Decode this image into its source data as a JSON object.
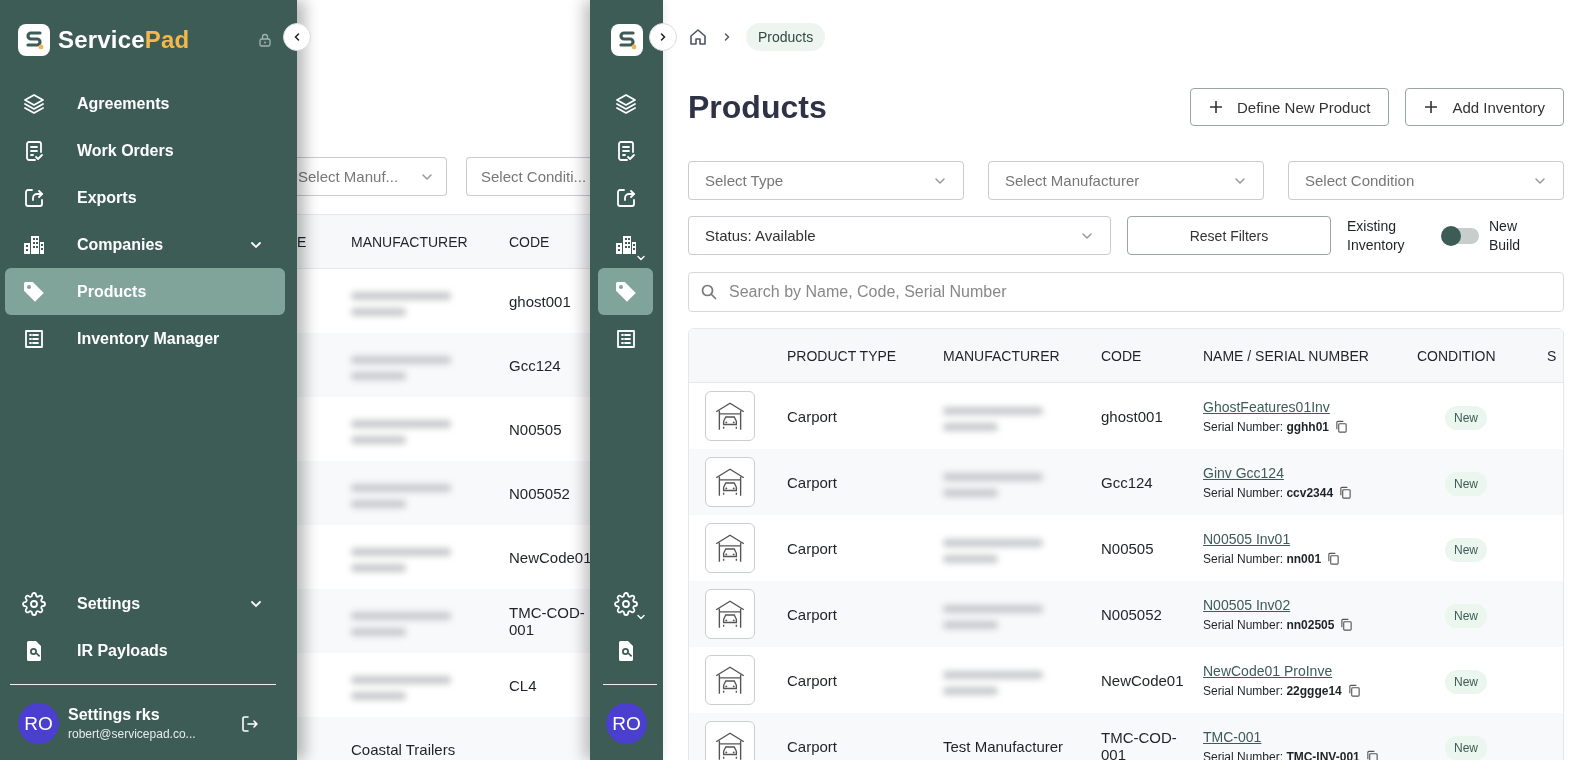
{
  "expanded_view": {
    "sidebar": {
      "brand": {
        "name": "Service",
        "accent": "Pad"
      },
      "items": [
        {
          "label": "Agreements",
          "kind": "layers",
          "selected": false,
          "expandable": false
        },
        {
          "label": "Work Orders",
          "kind": "checklist",
          "selected": false,
          "expandable": false
        },
        {
          "label": "Exports",
          "kind": "export",
          "selected": false,
          "expandable": false
        },
        {
          "label": "Companies",
          "kind": "buildings",
          "selected": false,
          "expandable": true
        },
        {
          "label": "Products",
          "kind": "tag",
          "selected": true,
          "expandable": false
        },
        {
          "label": "Inventory Manager",
          "kind": "list",
          "selected": false,
          "expandable": false
        }
      ],
      "bottom_items": [
        {
          "label": "Settings",
          "kind": "gear",
          "selected": false,
          "expandable": true
        },
        {
          "label": "IR Payloads",
          "kind": "search-doc",
          "selected": false,
          "expandable": false
        }
      ],
      "user": {
        "initials": "RO",
        "name": "Settings rks",
        "email": "robert@servicepad.co..."
      }
    },
    "background_page": {
      "filters": [
        "Select Manuf...",
        "Select Conditi..."
      ],
      "columns": [
        "E",
        "MANUFACTURER",
        "CODE"
      ],
      "rows": [
        {
          "manufacturer_blurred": true,
          "code": "ghost001"
        },
        {
          "manufacturer_blurred": true,
          "code": "Gcc124"
        },
        {
          "manufacturer_blurred": true,
          "code": "N00505"
        },
        {
          "manufacturer_blurred": true,
          "code": "N005052"
        },
        {
          "manufacturer_blurred": true,
          "code": "NewCode01"
        },
        {
          "manufacturer_blurred": true,
          "code": "TMC-COD-001"
        },
        {
          "manufacturer_blurred": true,
          "code": "CL4"
        },
        {
          "manufacturer_blurred": false,
          "manufacturer": "Coastal Trailers"
        }
      ]
    }
  },
  "collapsed_view": {
    "sidebar": {
      "items": [
        {
          "kind": "layers",
          "selected": false,
          "expandable": false
        },
        {
          "kind": "checklist",
          "selected": false,
          "expandable": false
        },
        {
          "kind": "export",
          "selected": false,
          "expandable": false
        },
        {
          "kind": "buildings",
          "selected": false,
          "expandable": true
        },
        {
          "kind": "tag",
          "selected": true,
          "expandable": false
        },
        {
          "kind": "list",
          "selected": false,
          "expandable": false
        }
      ],
      "bottom_items": [
        {
          "kind": "gear",
          "selected": false,
          "expandable": true
        },
        {
          "kind": "search-doc",
          "selected": false,
          "expandable": false
        }
      ],
      "user": {
        "initials": "RO"
      }
    },
    "breadcrumb": {
      "current": "Products"
    },
    "title": "Products",
    "actions": [
      "Define New Product",
      "Add Inventory"
    ],
    "filters": [
      {
        "placeholder": "Select Type"
      },
      {
        "placeholder": "Select Manufacturer"
      },
      {
        "placeholder": "Select Condition"
      }
    ],
    "status_filter": {
      "value": "Status: Available"
    },
    "reset_button": "Reset Filters",
    "inventory_toggle": {
      "left_label": "Existing Inventory",
      "right_label": "New Build",
      "on": false
    },
    "search": {
      "placeholder": "Search by Name, Code, Serial Number"
    },
    "table": {
      "columns": [
        "PRODUCT TYPE",
        "MANUFACTURER",
        "CODE",
        "NAME / SERIAL NUMBER",
        "CONDITION",
        "S"
      ],
      "rows": [
        {
          "product_type": "Carport",
          "manufacturer_blurred": true,
          "code": "ghost001",
          "name": "GhostFeatures01Inv",
          "serial_label": "Serial Number:",
          "serial": "gghh01",
          "condition": "New"
        },
        {
          "product_type": "Carport",
          "manufacturer_blurred": true,
          "code": "Gcc124",
          "name": "Ginv Gcc124",
          "serial_label": "Serial Number:",
          "serial": "ccv2344",
          "condition": "New"
        },
        {
          "product_type": "Carport",
          "manufacturer_blurred": true,
          "code": "N00505",
          "name": "N00505 Inv01",
          "serial_label": "Serial Number:",
          "serial": "nn001",
          "condition": "New"
        },
        {
          "product_type": "Carport",
          "manufacturer_blurred": true,
          "code": "N005052",
          "name": "N00505 Inv02",
          "serial_label": "Serial Number:",
          "serial": "nn02505",
          "condition": "New"
        },
        {
          "product_type": "Carport",
          "manufacturer_blurred": true,
          "code": "NewCode01",
          "name": "NewCode01 ProInve",
          "serial_label": "Serial Number:",
          "serial": "22ggge14",
          "condition": "New"
        },
        {
          "product_type": "Carport",
          "manufacturer_blurred": false,
          "manufacturer": "Test Manufacturer",
          "code": "TMC-COD-001",
          "name": "TMC-001",
          "serial_label": "Serial Number:",
          "serial": "TMC-INV-001",
          "condition": "New"
        }
      ]
    }
  }
}
